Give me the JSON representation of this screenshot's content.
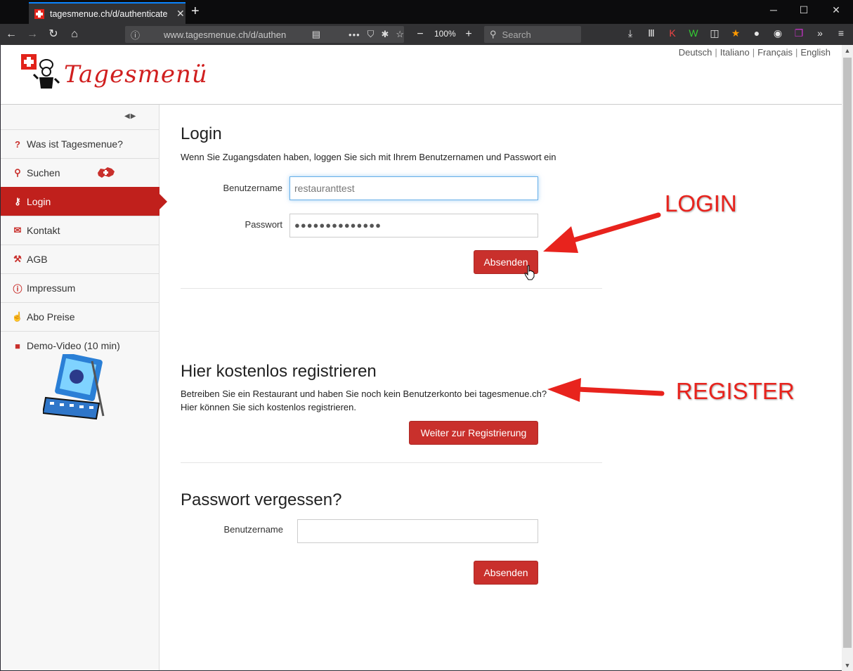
{
  "browser": {
    "tab_title": "tagesmenue.ch/d/authenticate",
    "url": "www.tagesmenue.ch/d/authen",
    "zoom": "100%",
    "search_placeholder": "Search"
  },
  "header": {
    "logo_text": "Tagesmenü",
    "languages": [
      "Deutsch",
      "Italiano",
      "Français",
      "English"
    ]
  },
  "sidebar": {
    "items": [
      {
        "label": "Was ist Tagesmenue?",
        "icon": "question-circle-icon"
      },
      {
        "label": "Suchen",
        "icon": "search-icon"
      },
      {
        "label": "Login",
        "icon": "key-icon",
        "active": true
      },
      {
        "label": "Kontakt",
        "icon": "envelope-icon"
      },
      {
        "label": "AGB",
        "icon": "gavel-icon"
      },
      {
        "label": "Impressum",
        "icon": "info-circle-icon"
      },
      {
        "label": "Abo Preise",
        "icon": "thumbs-up-icon"
      },
      {
        "label": "Demo-Video (10 min)",
        "icon": "video-camera-icon"
      }
    ]
  },
  "login": {
    "title": "Login",
    "description": "Wenn Sie Zugangsdaten haben, loggen Sie sich mit Ihrem Benutzernamen und Passwort ein",
    "username_label": "Benutzername",
    "username_value": "restauranttest",
    "password_label": "Passwort",
    "password_value": "●●●●●●●●●●●●●●",
    "submit_label": "Absenden"
  },
  "register": {
    "title": "Hier kostenlos registrieren",
    "description_line1": "Betreiben Sie ein Restaurant und haben Sie noch kein Benutzerkonto bei tagesmenue.ch?",
    "description_line2": "Hier können Sie sich kostenlos registrieren.",
    "button_label": "Weiter zur Registrierung"
  },
  "forgot": {
    "title": "Passwort vergessen?",
    "username_label": "Benutzername",
    "username_value": "",
    "submit_label": "Absenden"
  },
  "annotations": {
    "login": "LOGIN",
    "register": "REGISTER",
    "color": "#e8231d"
  },
  "colors": {
    "brand_red": "#c9302c",
    "active_menu": "#c0201c"
  }
}
